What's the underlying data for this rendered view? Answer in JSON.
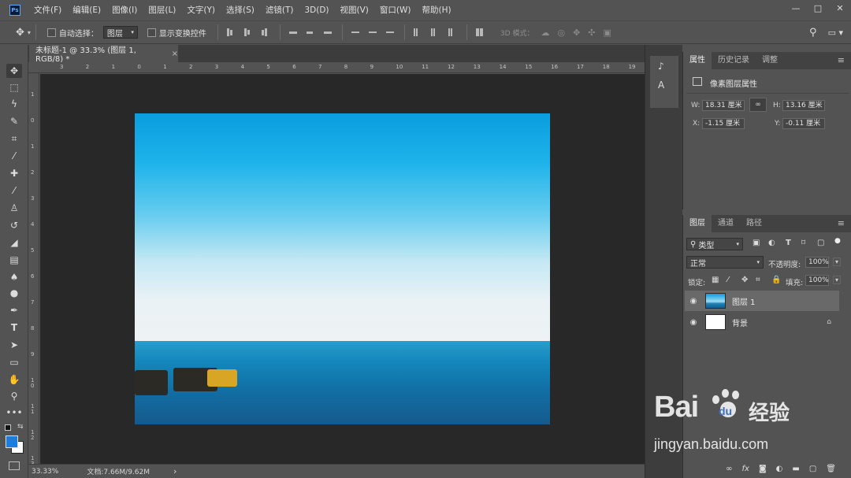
{
  "app": {
    "logo": "Ps"
  },
  "menu": [
    "文件(F)",
    "编辑(E)",
    "图像(I)",
    "图层(L)",
    "文字(Y)",
    "选择(S)",
    "滤镜(T)",
    "3D(D)",
    "视图(V)",
    "窗口(W)",
    "帮助(H)"
  ],
  "window_controls": {
    "minimize": "—",
    "restore": "□",
    "close": "✕"
  },
  "options": {
    "auto_select_label": "自动选择：",
    "auto_select_value": "图层",
    "show_transform_label": "显示变换控件",
    "mode_3d_label": "3D 模式："
  },
  "document_tab": {
    "title": "未标题-1 @ 33.3% (图层 1, RGB/8) *",
    "close": "×"
  },
  "ruler_h": [
    "3",
    "2",
    "1",
    "0",
    "1",
    "2",
    "3",
    "4",
    "5",
    "6",
    "7",
    "8",
    "9",
    "10",
    "11",
    "12",
    "13",
    "14",
    "15",
    "16",
    "17",
    "18",
    "19"
  ],
  "ruler_v": [
    "1",
    "0",
    "1",
    "2",
    "3",
    "4",
    "5",
    "6",
    "7",
    "8",
    "9",
    "1\n0",
    "1\n1",
    "1\n2",
    "1\n3",
    "1\n4"
  ],
  "status": {
    "zoom": "33.33%",
    "doc_size": "文档:7.66M/9.62M",
    "arrow": "›"
  },
  "properties_panel": {
    "tabs": [
      "属性",
      "历史记录",
      "调整"
    ],
    "title": "像素图层属性",
    "w_label": "W:",
    "w_value": "18.31 厘米",
    "h_label": "H:",
    "h_value": "13.16 厘米",
    "x_label": "X:",
    "x_value": "-1.15 厘米",
    "y_label": "Y:",
    "y_value": "-0.11 厘米"
  },
  "layers_panel": {
    "tabs": [
      "图层",
      "通道",
      "路径"
    ],
    "filter_label": "类型",
    "blend_mode": "正常",
    "opacity_label": "不透明度:",
    "opacity_value": "100%",
    "lock_label": "锁定:",
    "fill_label": "填充:",
    "fill_value": "100%",
    "layers": [
      {
        "name": "图层 1",
        "selected": true
      },
      {
        "name": "背景",
        "selected": false
      }
    ],
    "bottom_icons": [
      "link-icon",
      "fx-icon",
      "mask-icon",
      "adjustment-icon",
      "group-icon",
      "new-layer-icon",
      "trash-icon"
    ]
  },
  "watermark": {
    "brand": "Bai",
    "brand2": "du",
    "suffix": "经验",
    "url": "jingyan.baidu.com"
  }
}
